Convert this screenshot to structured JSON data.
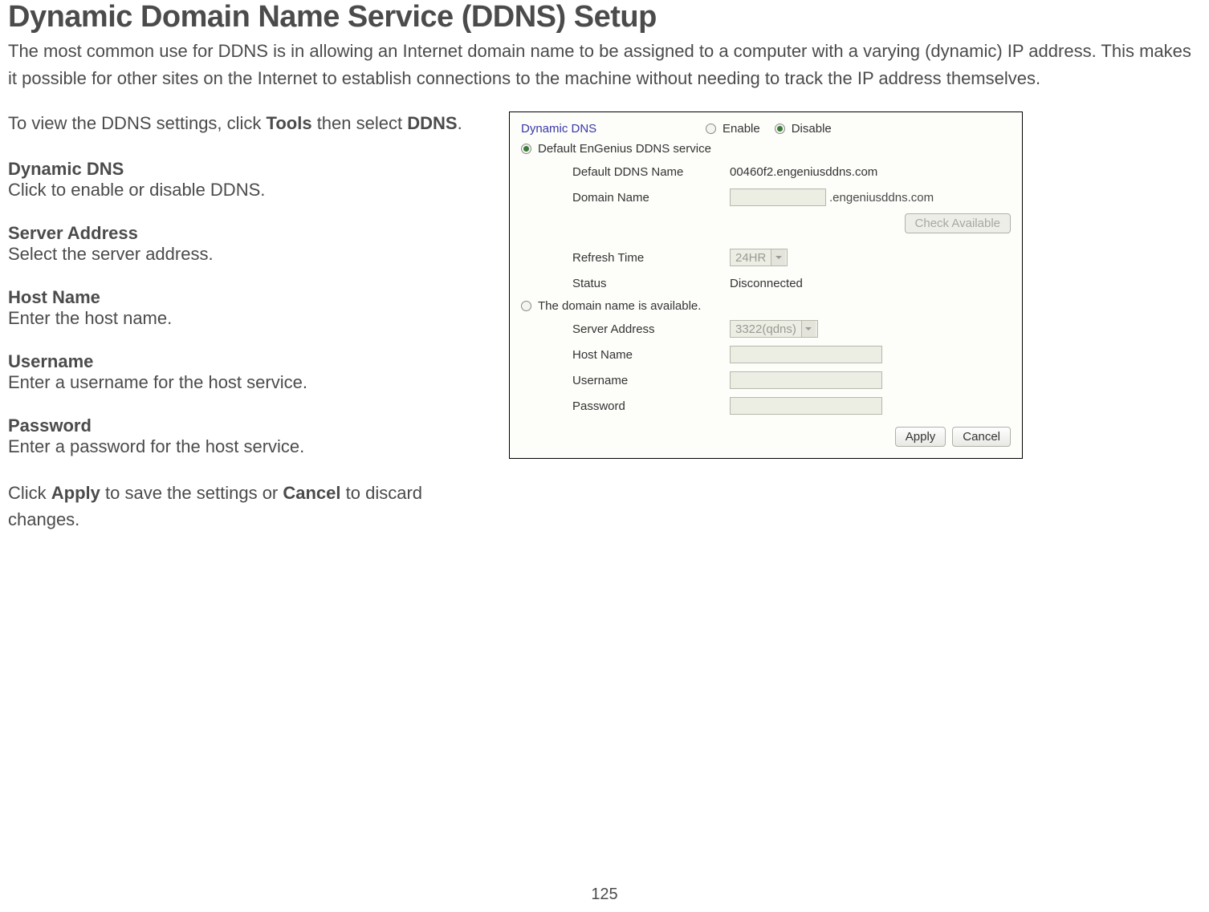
{
  "doc": {
    "title": "Dynamic Domain Name Service (DDNS) Setup",
    "intro": "The most common use for DDNS is in allowing an Internet domain name to be assigned to a computer with a varying (dynamic) IP address. This makes it possible for other sites on the Internet to establish connections to the machine without needing to track the IP address themselves.",
    "view_pre": "To view the DDNS settings, click ",
    "view_tools": "Tools",
    "view_mid": " then select ",
    "view_ddns": "DDNS",
    "view_post": ".",
    "field1_title": "Dynamic DNS",
    "field1_desc": "Click to enable or disable DDNS.",
    "field2_title": "Server Address",
    "field2_desc": "Select the server address.",
    "field3_title": "Host Name",
    "field3_desc": "Enter the host name.",
    "field4_title": "Username",
    "field4_desc": "Enter a username for the host service.",
    "field5_title": "Password",
    "field5_desc": "Enter a password for the host service.",
    "closing_pre": "Click ",
    "closing_apply": "Apply",
    "closing_mid": " to save the settings or ",
    "closing_cancel": "Cancel",
    "closing_post": " to discard changes.",
    "page_number": "125"
  },
  "panel": {
    "title": "Dynamic DNS",
    "enable": "Enable",
    "disable": "Disable",
    "section1_label": "Default EnGenius DDNS service",
    "default_name_label": "Default DDNS Name",
    "default_name_value": "00460f2.engeniusddns.com",
    "domain_name_label": "Domain Name",
    "domain_suffix": ".engeniusddns.com",
    "check_available": "Check Available",
    "refresh_label": "Refresh Time",
    "refresh_value": "24HR",
    "status_label": "Status",
    "status_value": "Disconnected",
    "section2_label": "The domain name is available.",
    "server_address_label": "Server Address",
    "server_address_value": "3322(qdns)",
    "host_name_label": "Host Name",
    "username_label": "Username",
    "password_label": "Password",
    "apply": "Apply",
    "cancel": "Cancel"
  }
}
